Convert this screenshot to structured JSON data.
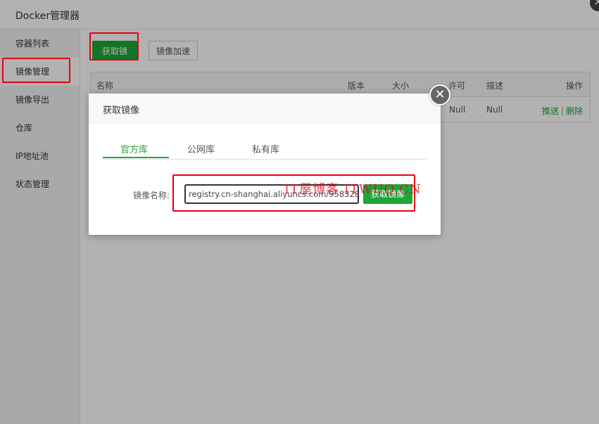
{
  "window": {
    "title": "Docker管理器",
    "close_symbol": "✕"
  },
  "sidebar": {
    "items": [
      {
        "label": "容器列表"
      },
      {
        "label": "镜像管理"
      },
      {
        "label": "镜像导出"
      },
      {
        "label": "仓库"
      },
      {
        "label": "IP地址池"
      },
      {
        "label": "状态管理"
      }
    ],
    "active_index": 1
  },
  "toolbar": {
    "get_image_label": "获取镜像",
    "accelerate_label": "镜像加速"
  },
  "table": {
    "columns": [
      "名称",
      "版本",
      "大小",
      "许可",
      "描述",
      "操作"
    ],
    "rows": [
      {
        "license": "Null",
        "description": "Null",
        "push": "推送",
        "separator": "|",
        "delete": "删除"
      }
    ]
  },
  "modal": {
    "title": "获取镜像",
    "close_symbol": "✕",
    "tabs": [
      {
        "label": "官方库"
      },
      {
        "label": "公网库"
      },
      {
        "label": "私有库"
      }
    ],
    "active_tab": 0,
    "field_label": "镜像名称:",
    "field_value": "registry.cn-shanghai.aliyuncs.com/958328",
    "submit_label": "获取镜像"
  },
  "watermark": "IT屋博客 ITWUQ.CN",
  "colors": {
    "accent": "#20a53a",
    "highlight": "#e60012"
  }
}
